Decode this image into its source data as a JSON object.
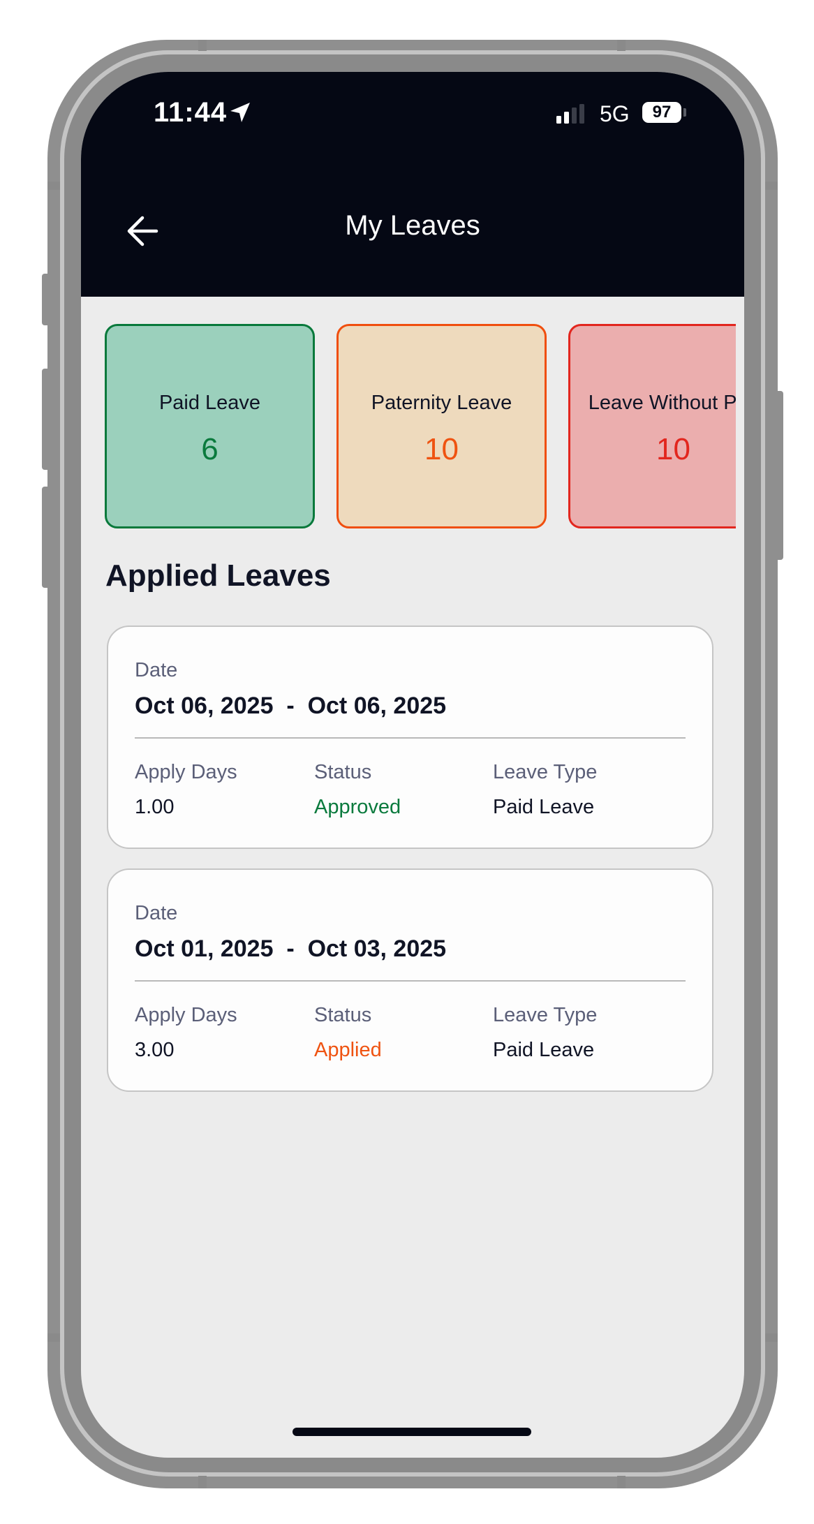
{
  "status_bar": {
    "time": "11:44",
    "network": "5G",
    "battery": "97"
  },
  "header": {
    "title": "My Leaves"
  },
  "balances": [
    {
      "name": "Paid Leave",
      "count": "6",
      "bg": "#9bd0bc",
      "border": "#08793b",
      "color": "#0a7a3d"
    },
    {
      "name": "Paternity Leave",
      "count": "10",
      "bg": "#eedabd",
      "border": "#f04e0e",
      "color": "#ef5311"
    },
    {
      "name": "Leave Without Pay",
      "count": "10",
      "bg": "#ebaeae",
      "border": "#e2261e",
      "color": "#e2261e"
    }
  ],
  "section": {
    "title": "Applied Leaves"
  },
  "labels": {
    "date": "Date",
    "apply_days": "Apply Days",
    "status": "Status",
    "leave_type": "Leave Type"
  },
  "applied_leaves": [
    {
      "date_range": "Oct 06, 2025  -  Oct 06, 2025",
      "apply_days": "1.00",
      "status": "Approved",
      "status_color": "#0a7a3d",
      "leave_type": "Paid Leave"
    },
    {
      "date_range": "Oct 01, 2025  -  Oct 03, 2025",
      "apply_days": "3.00",
      "status": "Applied",
      "status_color": "#ef5311",
      "leave_type": "Paid Leave"
    }
  ]
}
